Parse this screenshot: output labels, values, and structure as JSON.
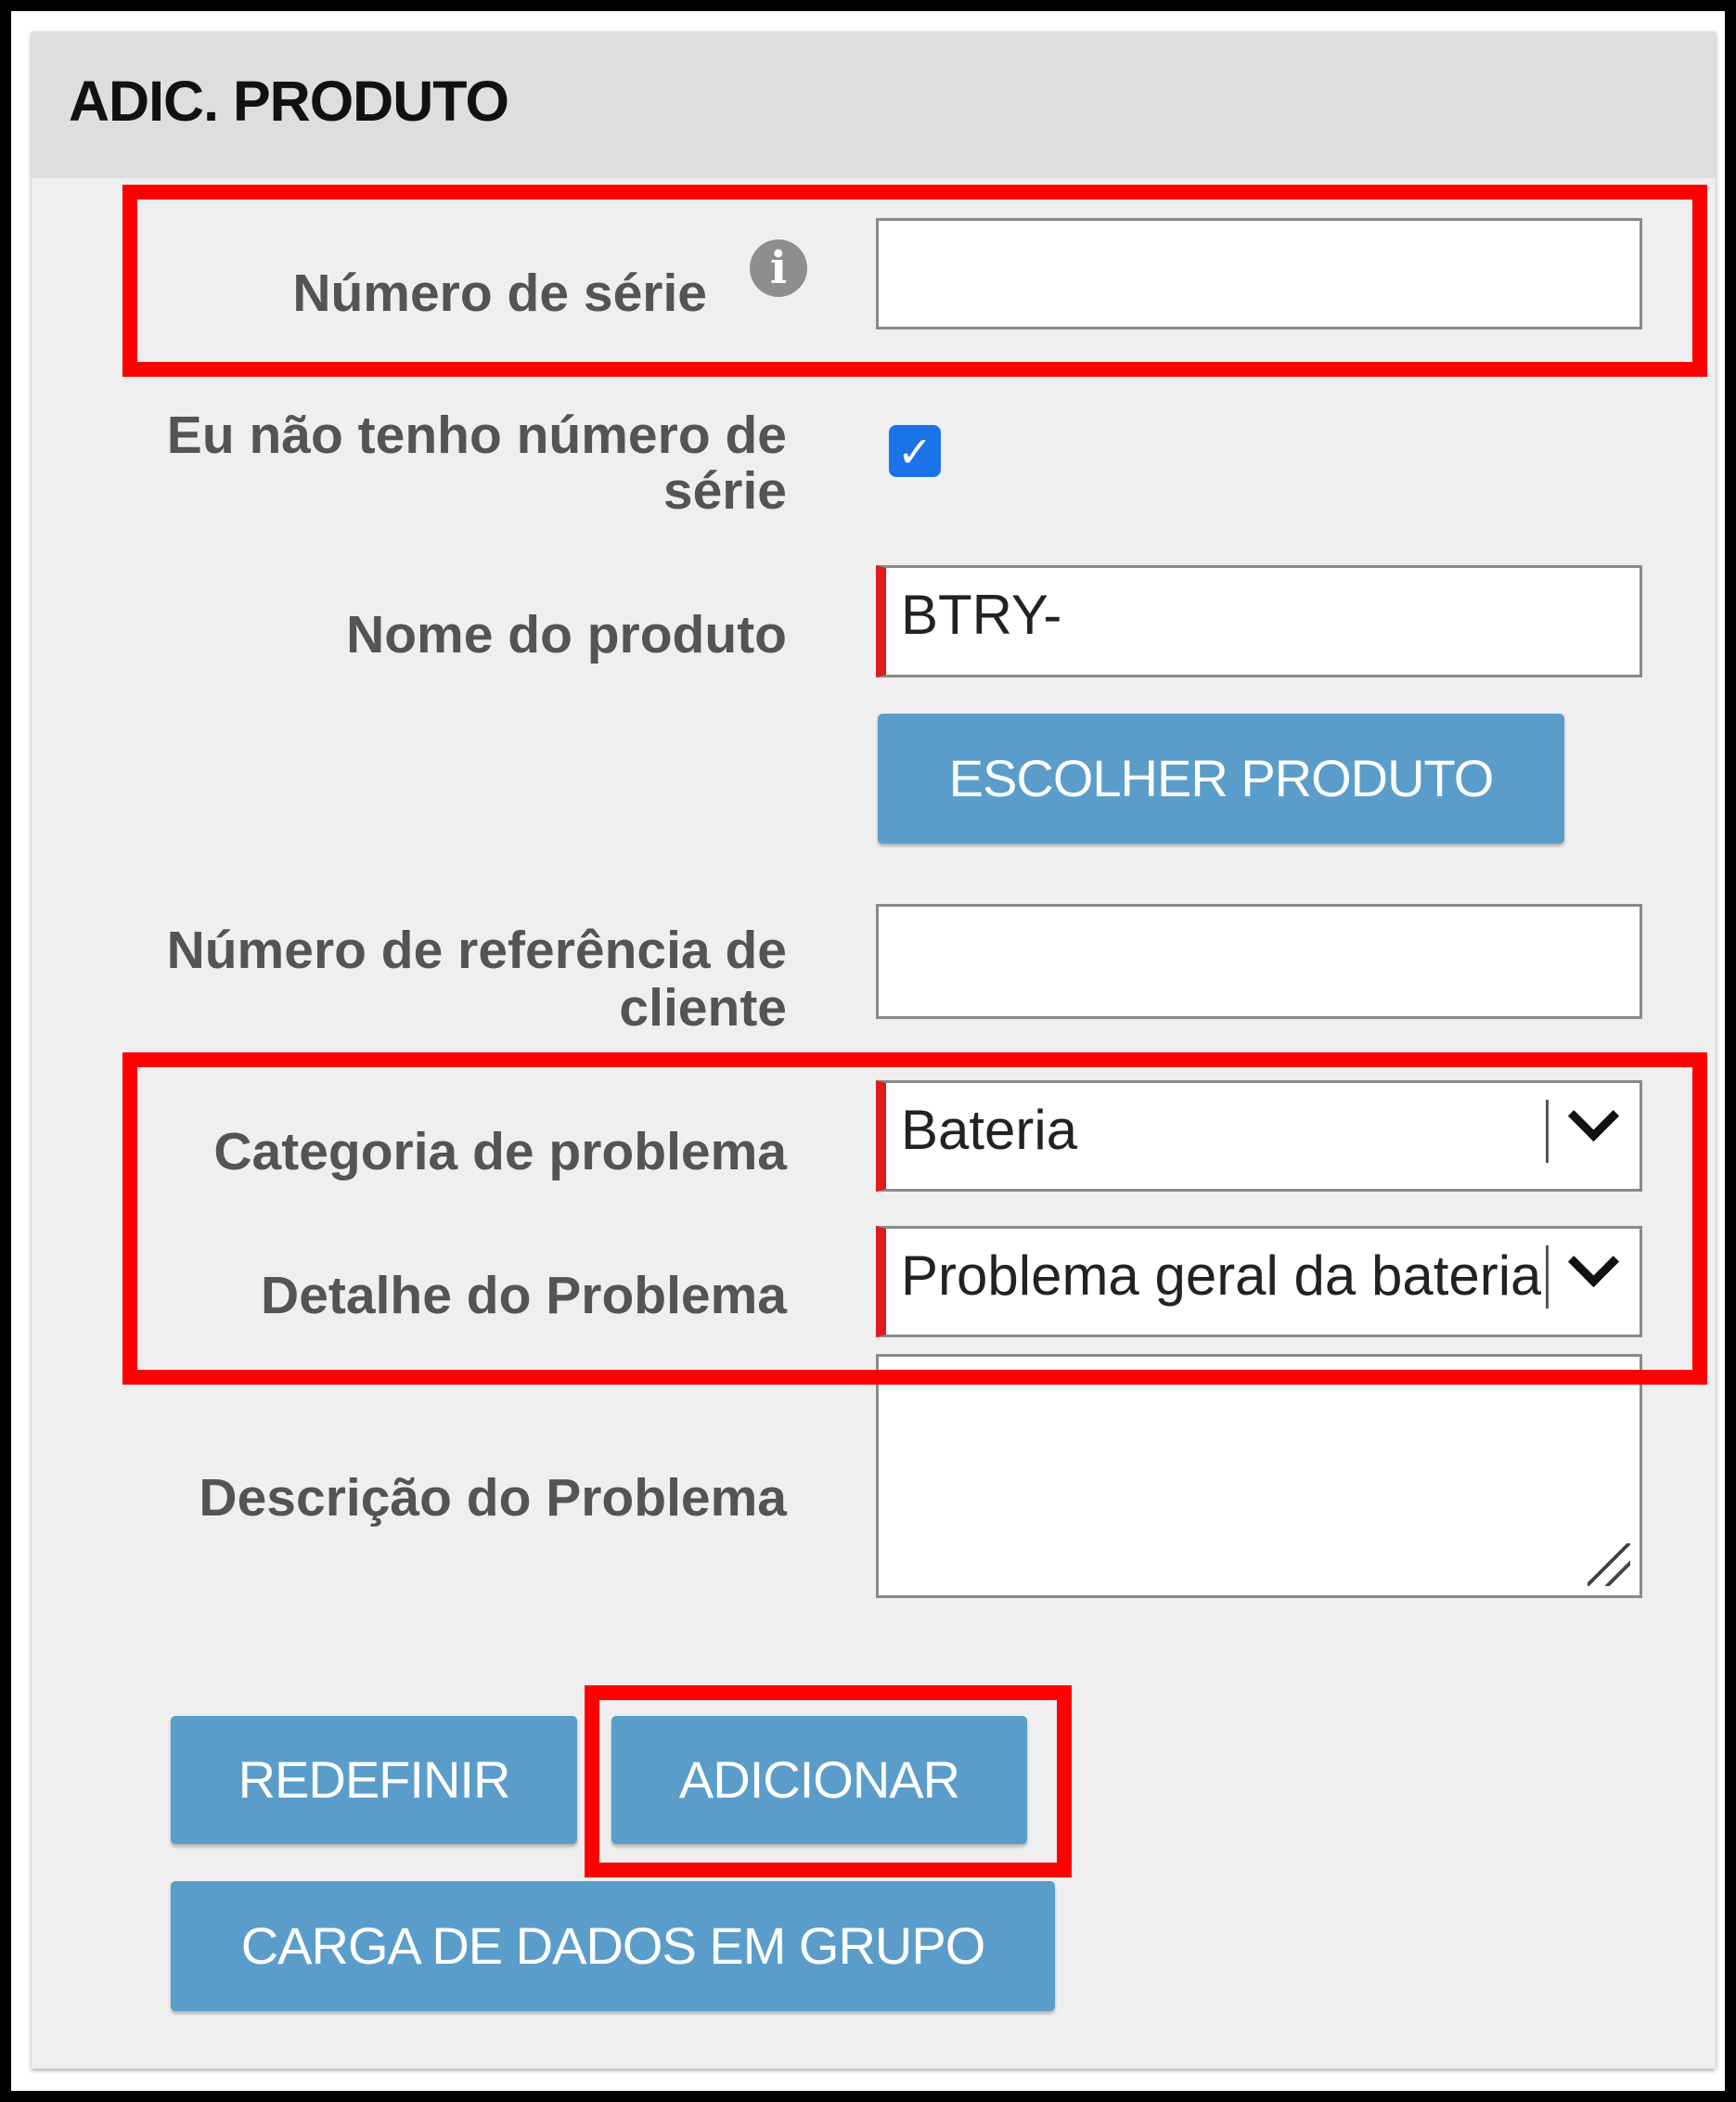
{
  "panel": {
    "title": "ADIC. PRODUTO"
  },
  "form": {
    "serial_number": {
      "label": "Número de série",
      "value": ""
    },
    "no_serial": {
      "label_line1": "Eu não tenho número de",
      "label_line2": "série",
      "checked": true,
      "check_mark": "✓"
    },
    "product_name": {
      "label": "Nome do produto",
      "value": "BTRY-"
    },
    "choose_product_button": "ESCOLHER PRODUTO",
    "customer_reference": {
      "label_line1": "Número de referência de",
      "label_line2": "cliente",
      "value": ""
    },
    "problem_category": {
      "label": "Categoria de problema",
      "selected": "Bateria"
    },
    "problem_detail": {
      "label": "Detalhe do Problema",
      "selected": "Problema geral da bateria"
    },
    "problem_description": {
      "label": "Descrição do Problema",
      "value": ""
    }
  },
  "buttons": {
    "reset": "REDEFINIR",
    "add": "ADICIONAR",
    "bulk_upload": "CARGA DE DADOS EM GRUPO"
  },
  "icons": {
    "info": "info-icon",
    "check": "checkbox-checked-icon",
    "dropdown": "chevron-down-icon",
    "resize": "resize-grip-icon"
  },
  "colors": {
    "button": "#5a9dca",
    "required_marker": "#e01b1b",
    "highlight": "#ff0000",
    "checkbox": "#1a73e8"
  }
}
